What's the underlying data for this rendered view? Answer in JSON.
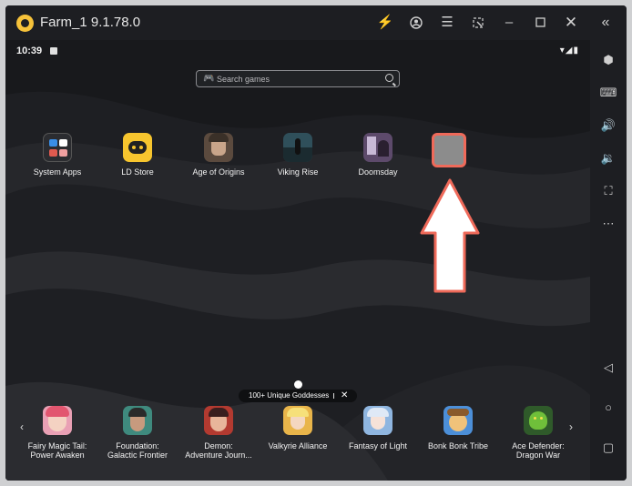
{
  "window": {
    "title": "Farm_1 9.1.78.0"
  },
  "status_bar": {
    "time": "10:39"
  },
  "search": {
    "placeholder": "Search games"
  },
  "apps": [
    {
      "label": "System Apps"
    },
    {
      "label": "LD Store"
    },
    {
      "label": "Age of Origins"
    },
    {
      "label": "Viking Rise"
    },
    {
      "label": "Doomsday"
    }
  ],
  "promo": {
    "text": "100+ Unique Goddesses"
  },
  "games": [
    {
      "line1": "Fairy Magic Tail:",
      "line2": "Power Awaken"
    },
    {
      "line1": "Foundation:",
      "line2": "Galactic Frontier"
    },
    {
      "line1": "Demon:",
      "line2": "Adventure Journ..."
    },
    {
      "line1": "Valkyrie Alliance",
      "line2": ""
    },
    {
      "line1": "Fantasy of Light",
      "line2": ""
    },
    {
      "line1": "Bonk Bonk Tribe",
      "line2": ""
    },
    {
      "line1": "Ace Defender:",
      "line2": "Dragon War"
    }
  ],
  "colors": {
    "accent_red": "#ef6a5a",
    "logo_yellow": "#f6c23a",
    "bolt_blue": "#4a7cff"
  }
}
